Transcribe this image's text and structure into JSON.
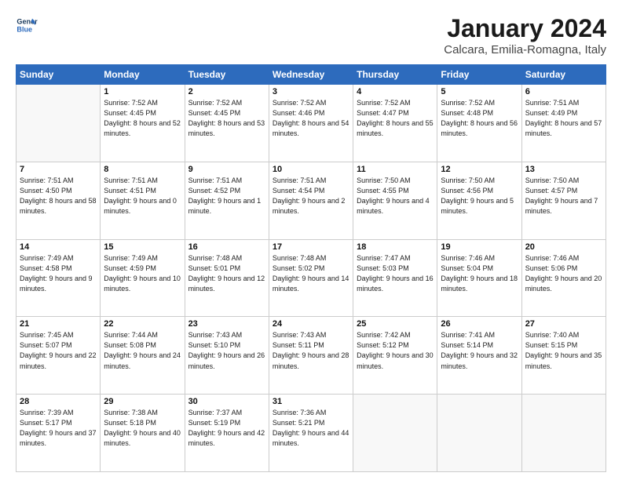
{
  "header": {
    "logo_line1": "General",
    "logo_line2": "Blue",
    "title": "January 2024",
    "subtitle": "Calcara, Emilia-Romagna, Italy"
  },
  "days_of_week": [
    "Sunday",
    "Monday",
    "Tuesday",
    "Wednesday",
    "Thursday",
    "Friday",
    "Saturday"
  ],
  "weeks": [
    [
      {
        "day": "",
        "sunrise": "",
        "sunset": "",
        "daylight": ""
      },
      {
        "day": "1",
        "sunrise": "7:52 AM",
        "sunset": "4:45 PM",
        "daylight": "8 hours and 52 minutes."
      },
      {
        "day": "2",
        "sunrise": "7:52 AM",
        "sunset": "4:45 PM",
        "daylight": "8 hours and 53 minutes."
      },
      {
        "day": "3",
        "sunrise": "7:52 AM",
        "sunset": "4:46 PM",
        "daylight": "8 hours and 54 minutes."
      },
      {
        "day": "4",
        "sunrise": "7:52 AM",
        "sunset": "4:47 PM",
        "daylight": "8 hours and 55 minutes."
      },
      {
        "day": "5",
        "sunrise": "7:52 AM",
        "sunset": "4:48 PM",
        "daylight": "8 hours and 56 minutes."
      },
      {
        "day": "6",
        "sunrise": "7:51 AM",
        "sunset": "4:49 PM",
        "daylight": "8 hours and 57 minutes."
      }
    ],
    [
      {
        "day": "7",
        "sunrise": "7:51 AM",
        "sunset": "4:50 PM",
        "daylight": "8 hours and 58 minutes."
      },
      {
        "day": "8",
        "sunrise": "7:51 AM",
        "sunset": "4:51 PM",
        "daylight": "9 hours and 0 minutes."
      },
      {
        "day": "9",
        "sunrise": "7:51 AM",
        "sunset": "4:52 PM",
        "daylight": "9 hours and 1 minute."
      },
      {
        "day": "10",
        "sunrise": "7:51 AM",
        "sunset": "4:54 PM",
        "daylight": "9 hours and 2 minutes."
      },
      {
        "day": "11",
        "sunrise": "7:50 AM",
        "sunset": "4:55 PM",
        "daylight": "9 hours and 4 minutes."
      },
      {
        "day": "12",
        "sunrise": "7:50 AM",
        "sunset": "4:56 PM",
        "daylight": "9 hours and 5 minutes."
      },
      {
        "day": "13",
        "sunrise": "7:50 AM",
        "sunset": "4:57 PM",
        "daylight": "9 hours and 7 minutes."
      }
    ],
    [
      {
        "day": "14",
        "sunrise": "7:49 AM",
        "sunset": "4:58 PM",
        "daylight": "9 hours and 9 minutes."
      },
      {
        "day": "15",
        "sunrise": "7:49 AM",
        "sunset": "4:59 PM",
        "daylight": "9 hours and 10 minutes."
      },
      {
        "day": "16",
        "sunrise": "7:48 AM",
        "sunset": "5:01 PM",
        "daylight": "9 hours and 12 minutes."
      },
      {
        "day": "17",
        "sunrise": "7:48 AM",
        "sunset": "5:02 PM",
        "daylight": "9 hours and 14 minutes."
      },
      {
        "day": "18",
        "sunrise": "7:47 AM",
        "sunset": "5:03 PM",
        "daylight": "9 hours and 16 minutes."
      },
      {
        "day": "19",
        "sunrise": "7:46 AM",
        "sunset": "5:04 PM",
        "daylight": "9 hours and 18 minutes."
      },
      {
        "day": "20",
        "sunrise": "7:46 AM",
        "sunset": "5:06 PM",
        "daylight": "9 hours and 20 minutes."
      }
    ],
    [
      {
        "day": "21",
        "sunrise": "7:45 AM",
        "sunset": "5:07 PM",
        "daylight": "9 hours and 22 minutes."
      },
      {
        "day": "22",
        "sunrise": "7:44 AM",
        "sunset": "5:08 PM",
        "daylight": "9 hours and 24 minutes."
      },
      {
        "day": "23",
        "sunrise": "7:43 AM",
        "sunset": "5:10 PM",
        "daylight": "9 hours and 26 minutes."
      },
      {
        "day": "24",
        "sunrise": "7:43 AM",
        "sunset": "5:11 PM",
        "daylight": "9 hours and 28 minutes."
      },
      {
        "day": "25",
        "sunrise": "7:42 AM",
        "sunset": "5:12 PM",
        "daylight": "9 hours and 30 minutes."
      },
      {
        "day": "26",
        "sunrise": "7:41 AM",
        "sunset": "5:14 PM",
        "daylight": "9 hours and 32 minutes."
      },
      {
        "day": "27",
        "sunrise": "7:40 AM",
        "sunset": "5:15 PM",
        "daylight": "9 hours and 35 minutes."
      }
    ],
    [
      {
        "day": "28",
        "sunrise": "7:39 AM",
        "sunset": "5:17 PM",
        "daylight": "9 hours and 37 minutes."
      },
      {
        "day": "29",
        "sunrise": "7:38 AM",
        "sunset": "5:18 PM",
        "daylight": "9 hours and 40 minutes."
      },
      {
        "day": "30",
        "sunrise": "7:37 AM",
        "sunset": "5:19 PM",
        "daylight": "9 hours and 42 minutes."
      },
      {
        "day": "31",
        "sunrise": "7:36 AM",
        "sunset": "5:21 PM",
        "daylight": "9 hours and 44 minutes."
      },
      {
        "day": "",
        "sunrise": "",
        "sunset": "",
        "daylight": ""
      },
      {
        "day": "",
        "sunrise": "",
        "sunset": "",
        "daylight": ""
      },
      {
        "day": "",
        "sunrise": "",
        "sunset": "",
        "daylight": ""
      }
    ]
  ]
}
